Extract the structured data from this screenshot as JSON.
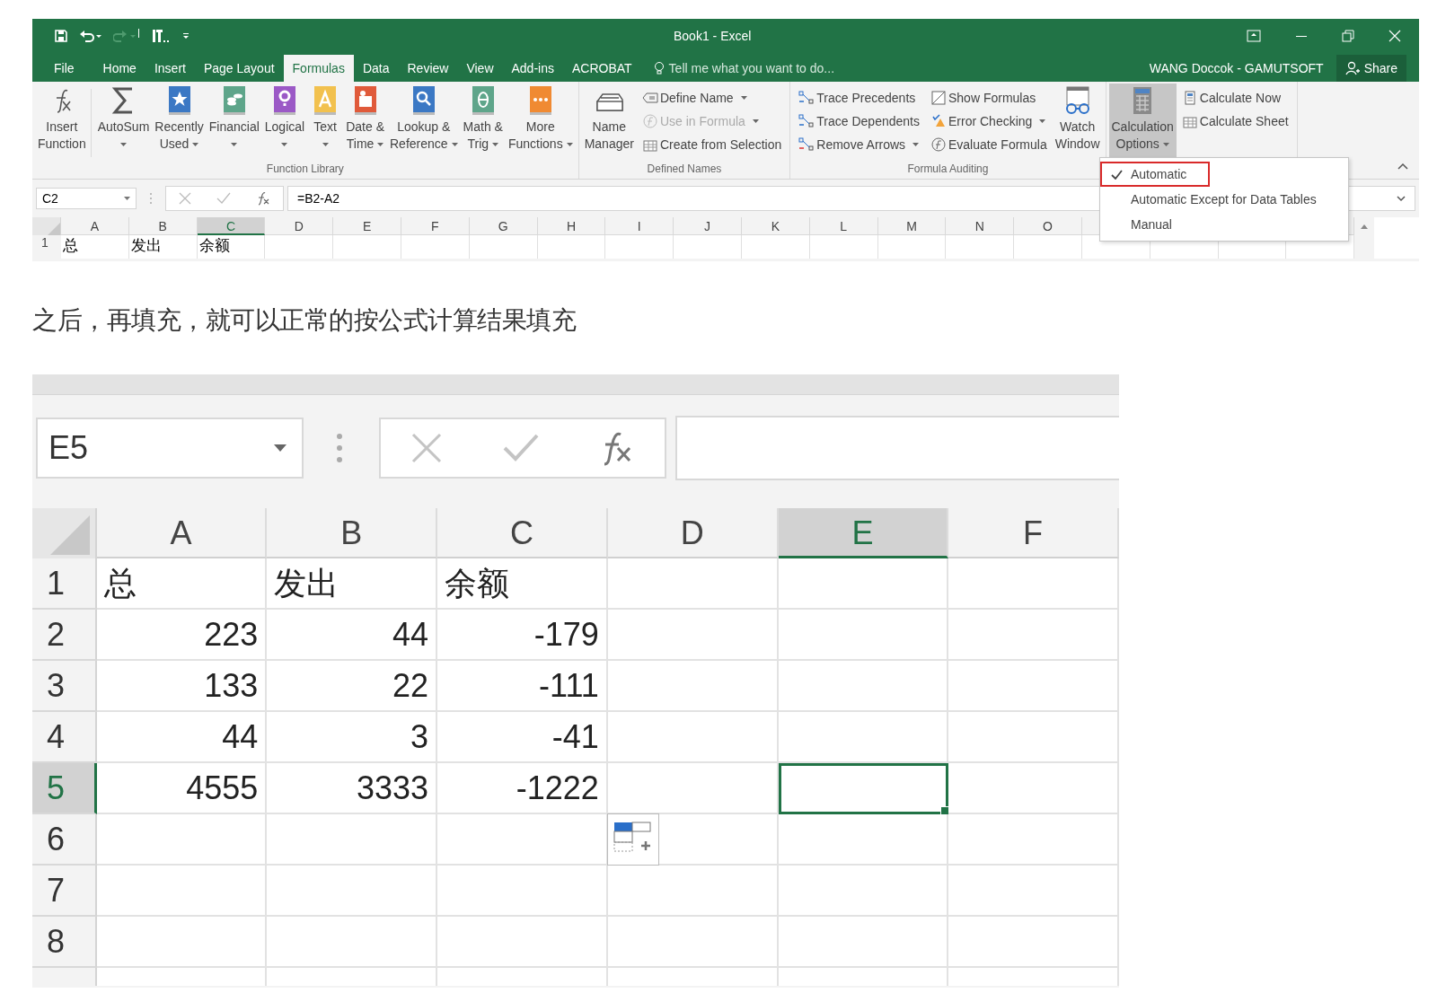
{
  "screenshot_1": {
    "window_title": "Book1 - Excel",
    "tabs": [
      {
        "label": "File",
        "selected": false
      },
      {
        "label": "Home",
        "selected": false
      },
      {
        "label": "Insert",
        "selected": false
      },
      {
        "label": "Page Layout",
        "selected": false
      },
      {
        "label": "Formulas",
        "selected": true
      },
      {
        "label": "Data",
        "selected": false
      },
      {
        "label": "Review",
        "selected": false
      },
      {
        "label": "View",
        "selected": false
      },
      {
        "label": "Add-ins",
        "selected": false
      },
      {
        "label": "ACROBAT",
        "selected": false
      }
    ],
    "tell_me": "Tell me what you want to do...",
    "user": "WANG Doccok - GAMUTSOFT",
    "share": "Share",
    "groups": [
      {
        "label": "Function Library",
        "items": [
          {
            "kind": "large",
            "lines": [
              "Insert",
              "Function"
            ],
            "dropdown": false,
            "pressed": false
          },
          {
            "kind": "large",
            "lines": [
              "AutoSum"
            ],
            "dropdown": true,
            "pressed": false
          },
          {
            "kind": "large",
            "color": "#3b78c4",
            "lines": [
              "Recently",
              "Used"
            ],
            "dropdown": true,
            "pressed": false
          },
          {
            "kind": "large",
            "color": "#5ea58a",
            "lines": [
              "Financial"
            ],
            "dropdown": true,
            "pressed": false
          },
          {
            "kind": "large",
            "color": "#9b59c6",
            "lines": [
              "Logical"
            ],
            "dropdown": true,
            "pressed": false
          },
          {
            "kind": "large",
            "color": "#f2c14e",
            "lines": [
              "Text"
            ],
            "dropdown": true,
            "pressed": false
          },
          {
            "kind": "large",
            "color": "#e05a3a",
            "lines": [
              "Date &",
              "Time"
            ],
            "dropdown": true,
            "pressed": false
          },
          {
            "kind": "large",
            "color": "#3b78c4",
            "lines": [
              "Lookup &",
              "Reference"
            ],
            "dropdown": true,
            "pressed": false
          },
          {
            "kind": "large",
            "color": "#5ea58a",
            "lines": [
              "Math &",
              "Trig"
            ],
            "dropdown": true,
            "pressed": false
          },
          {
            "kind": "large",
            "color": "#f08a32",
            "lines": [
              "More",
              "Functions"
            ],
            "dropdown": true,
            "pressed": false
          }
        ]
      },
      {
        "label": "Defined Names",
        "items": [
          {
            "kind": "large",
            "lines": [
              "Name",
              "Manager"
            ],
            "dropdown": false,
            "pressed": false
          },
          {
            "kind": "column",
            "entries": [
              {
                "label": "Define Name",
                "dropdown": true,
                "disabled": false
              },
              {
                "label": "Use in Formula",
                "dropdown": true,
                "disabled": true
              },
              {
                "label": "Create from Selection",
                "dropdown": false,
                "disabled": false
              }
            ]
          }
        ]
      },
      {
        "label": "Formula Auditing",
        "items": [
          {
            "kind": "column",
            "entries": [
              {
                "label": "Trace Precedents",
                "dropdown": false,
                "disabled": false
              },
              {
                "label": "Trace Dependents",
                "dropdown": false,
                "disabled": false
              },
              {
                "label": "Remove Arrows",
                "dropdown": true,
                "disabled": false
              }
            ]
          },
          {
            "kind": "column",
            "entries": [
              {
                "label": "Show Formulas",
                "dropdown": false,
                "disabled": false
              },
              {
                "label": "Error Checking",
                "dropdown": true,
                "disabled": false
              },
              {
                "label": "Evaluate Formula",
                "dropdown": false,
                "disabled": false
              }
            ]
          },
          {
            "kind": "large",
            "lines": [
              "Watch",
              "Window"
            ],
            "dropdown": false,
            "pressed": false
          }
        ]
      },
      {
        "items": [
          {
            "kind": "large",
            "lines": [
              "Calculation",
              "Options"
            ],
            "dropdown": true,
            "pressed": true
          },
          {
            "kind": "column",
            "entries": [
              {
                "label": "Calculate Now",
                "dropdown": false,
                "disabled": false
              },
              {
                "label": "Calculate Sheet",
                "dropdown": false,
                "disabled": false
              }
            ]
          }
        ]
      }
    ],
    "menu": [
      {
        "label": "Automatic",
        "checked": true,
        "highlighted": true
      },
      {
        "label": "Automatic Except for Data Tables",
        "checked": false,
        "highlighted": false
      },
      {
        "label": "Manual",
        "checked": false,
        "highlighted": false
      }
    ],
    "name_box": "C2",
    "formula": "=B2-A2",
    "columns": [
      {
        "label": "A",
        "selected": false
      },
      {
        "label": "B",
        "selected": false
      },
      {
        "label": "C",
        "selected": true
      },
      {
        "label": "D",
        "selected": false
      },
      {
        "label": "E",
        "selected": false
      },
      {
        "label": "F",
        "selected": false
      },
      {
        "label": "G",
        "selected": false
      },
      {
        "label": "H",
        "selected": false
      },
      {
        "label": "I",
        "selected": false
      },
      {
        "label": "J",
        "selected": false
      },
      {
        "label": "K",
        "selected": false
      },
      {
        "label": "L",
        "selected": false
      },
      {
        "label": "M",
        "selected": false
      },
      {
        "label": "N",
        "selected": false
      },
      {
        "label": "O",
        "selected": false
      }
    ],
    "rows": [
      {
        "label": "1",
        "cells": [
          "总",
          "发出",
          "余额"
        ]
      }
    ]
  },
  "article_text": "之后，再填充，就可以正常的按公式计算结果填充",
  "screenshot_2": {
    "name_box": "E5",
    "columns": [
      {
        "label": "A",
        "selected": false
      },
      {
        "label": "B",
        "selected": false
      },
      {
        "label": "C",
        "selected": false
      },
      {
        "label": "D",
        "selected": false
      },
      {
        "label": "E",
        "selected": true
      },
      {
        "label": "F",
        "selected": false
      }
    ],
    "rows": [
      {
        "label": "1",
        "kind": "text",
        "selected": false,
        "cells": [
          "总",
          "发出",
          "余额"
        ]
      },
      {
        "label": "2",
        "kind": "number",
        "selected": false,
        "cells": [
          "223",
          "44",
          "-179"
        ]
      },
      {
        "label": "3",
        "kind": "number",
        "selected": false,
        "cells": [
          "133",
          "22",
          "-111"
        ]
      },
      {
        "label": "4",
        "kind": "number",
        "selected": false,
        "cells": [
          "44",
          "3",
          "-41"
        ]
      },
      {
        "label": "5",
        "kind": "number",
        "selected": true,
        "cells": [
          "4555",
          "3333",
          "-1222"
        ]
      },
      {
        "label": "6",
        "kind": "number",
        "selected": false,
        "cells": []
      },
      {
        "label": "7",
        "kind": "number",
        "selected": false,
        "cells": []
      },
      {
        "label": "8",
        "kind": "number",
        "selected": false,
        "cells": []
      }
    ]
  }
}
